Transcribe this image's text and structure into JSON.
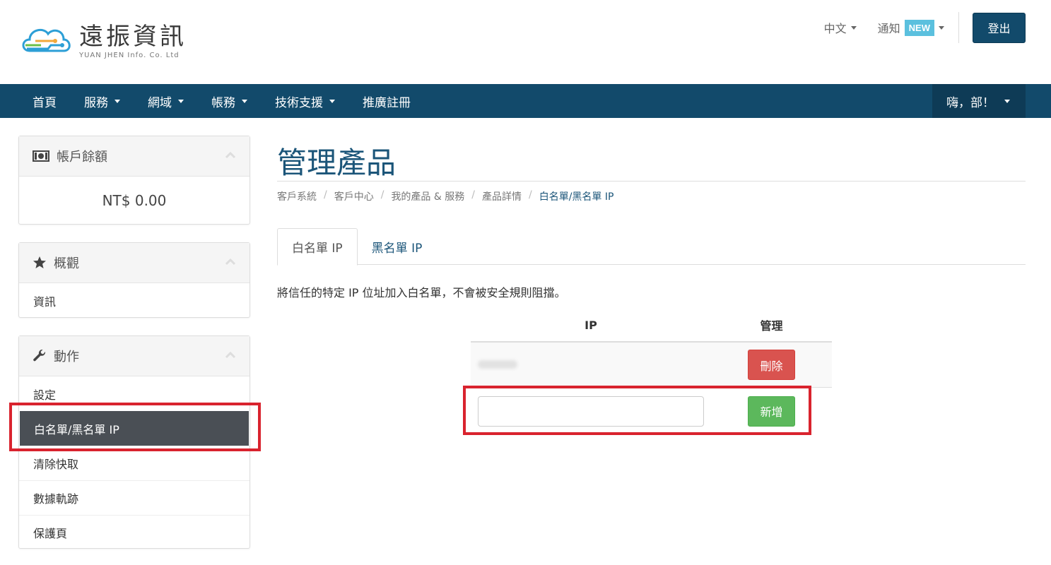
{
  "header": {
    "logo_title": "遠振資訊",
    "logo_subtitle": "YUAN JHEN Info. Co. Ltd",
    "language": "中文",
    "notifications_label": "通知",
    "new_badge": "NEW",
    "logout_label": "登出"
  },
  "navbar": {
    "items": [
      {
        "label": "首頁",
        "dropdown": false
      },
      {
        "label": "服務",
        "dropdown": true
      },
      {
        "label": "網域",
        "dropdown": true
      },
      {
        "label": "帳務",
        "dropdown": true
      },
      {
        "label": "技術支援",
        "dropdown": true
      },
      {
        "label": "推廣註冊",
        "dropdown": false
      }
    ],
    "user_greeting": "嗨，部！"
  },
  "sidebar": {
    "balance": {
      "title": "帳戶餘額",
      "amount": "NT$ 0.00"
    },
    "overview": {
      "title": "概觀",
      "items": [
        "資訊"
      ]
    },
    "actions": {
      "title": "動作",
      "items": [
        "設定",
        "白名單/黑名單 IP",
        "清除快取",
        "數據軌跡",
        "保護頁"
      ],
      "active_index": 1
    }
  },
  "main": {
    "title": "管理產品",
    "breadcrumb": [
      "客戶系統",
      "客戶中心",
      "我的產品 & 服務",
      "產品詳情",
      "白名單/黑名單 IP"
    ],
    "tabs": [
      "白名單 IP",
      "黑名單 IP"
    ],
    "description": "將信任的特定 IP 位址加入白名單，不會被安全規則阻擋。",
    "table": {
      "headers": {
        "ip": "IP",
        "manage": "管理"
      },
      "rows": [
        {
          "ip": "1.2.3.4",
          "action": "刪除"
        }
      ],
      "add_button": "新增",
      "input_value": ""
    }
  },
  "colors": {
    "brand": "#124a6b",
    "highlight": "#d9232e",
    "danger": "#d9534f",
    "success": "#5cb85c",
    "badge": "#5bc0de"
  }
}
